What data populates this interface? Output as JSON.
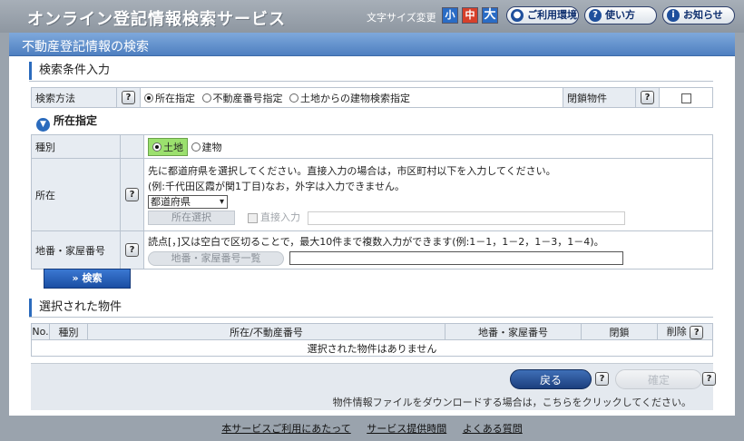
{
  "header": {
    "title": "オンライン登記情報検索サービス",
    "font_size_label": "文字サイズ変更",
    "font_sizes": [
      "小",
      "中",
      "大"
    ],
    "buttons": {
      "environment": "ご利用環境",
      "help": "使い方",
      "news": "お知らせ"
    }
  },
  "page": {
    "banner_title": "不動産登記情報の検索",
    "conditions_title": "検索条件入力"
  },
  "search_method": {
    "label": "検索方法",
    "options": [
      "所在指定",
      "不動産番号指定",
      "土地からの建物検索指定"
    ],
    "selected": "所在指定",
    "closed_label": "閉鎖物件"
  },
  "location_section": {
    "title": "所在指定",
    "type_label": "種別",
    "type_options": [
      "土地",
      "建物"
    ],
    "type_selected": "土地",
    "location_label": "所在",
    "location_note1": "先に都道府県を選択してください。直接入力の場合は，市区町村以下を入力してください。",
    "location_note2": "(例:千代田区霞が関1丁目)なお，外字は入力できません。",
    "prefecture_select": "都道府県",
    "location_select_button": "所在選択",
    "direct_input_label": "直接入力",
    "lot_label": "地番・家屋番号",
    "lot_note": "読点[，]又は空白で区切ることで，最大10件まで複数入力ができます(例:1－1，1－2，1－3，1－4)。",
    "lot_list_button": "地番・家屋番号一覧"
  },
  "search_button": "» 検索",
  "selected_section": {
    "title": "選択された物件",
    "columns": [
      "No.",
      "種別",
      "所在/不動産番号",
      "地番・家屋番号",
      "閉鎖",
      "削除"
    ],
    "empty_message": "選択された物件はありません"
  },
  "footer": {
    "back_button": "戻る",
    "confirm_button": "確定",
    "download_note": "物件情報ファイルをダウンロードする場合は，こちらをクリックしてください。"
  },
  "bottom_links": [
    "本サービスご利用にあたって",
    "サービス提供時間",
    "よくある質問"
  ]
}
